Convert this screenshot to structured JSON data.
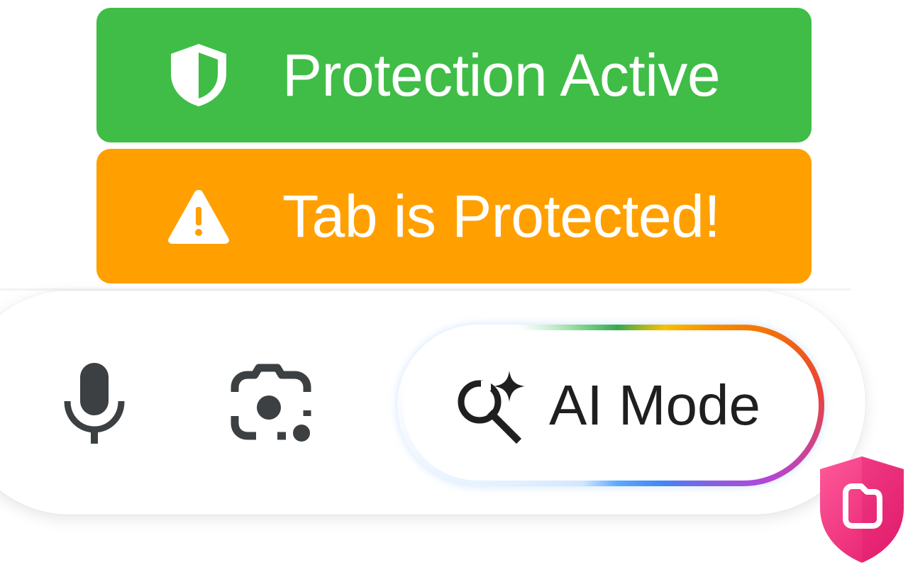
{
  "banners": {
    "protection": {
      "label": "Protection Active",
      "color": "#3fbd46",
      "icon": "shield-icon"
    },
    "warning": {
      "label": "Tab is Protected!",
      "color": "#ffa000",
      "icon": "warning-triangle-icon"
    }
  },
  "searchbar": {
    "mic_icon": "microphone-icon",
    "lens_icon": "camera-lens-icon",
    "ai_mode": {
      "label": "AI Mode",
      "icon": "sparkle-search-icon"
    }
  },
  "extension_badge": {
    "icon": "shield-folder-icon",
    "color": "#f0307a"
  }
}
